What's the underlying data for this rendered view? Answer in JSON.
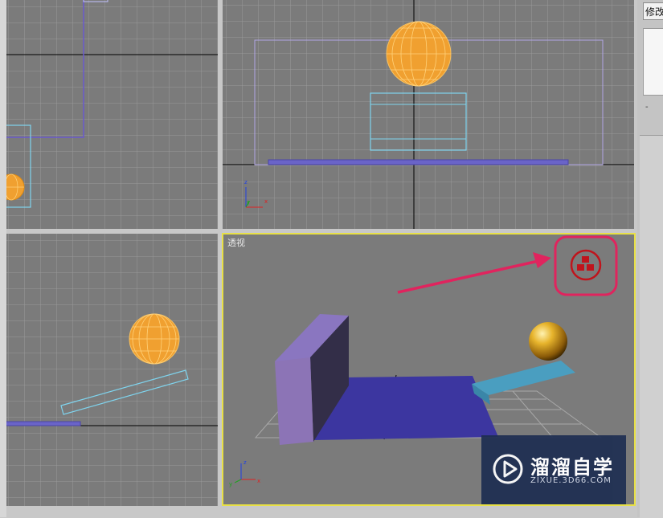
{
  "command_panel": {
    "modify_tab_label": "修改",
    "panel_caption": "-"
  },
  "viewports": {
    "perspective_label": "透视",
    "axis_labels": {
      "x": "x",
      "y": "y",
      "z": "z"
    }
  },
  "watermark": {
    "brand_cn": "溜溜自学",
    "brand_en": "ZIXUE.3D66.COM"
  },
  "colors": {
    "viewport_bg": "#7b7b7b",
    "grid_line": "#9a9a9a",
    "active_border": "#e8e046",
    "sphere_wire": "#f4a63a",
    "highlight_circle": "#e0245e",
    "arrow": "#e0245e",
    "icon_red": "#c0141c",
    "box_wire": "#7fd4ee",
    "plane_wire": "#9a86d8"
  },
  "icons": {
    "highlighted_toolbar_icon": "pyramid-blocks-icon",
    "watermark_logo": "play-icon"
  }
}
